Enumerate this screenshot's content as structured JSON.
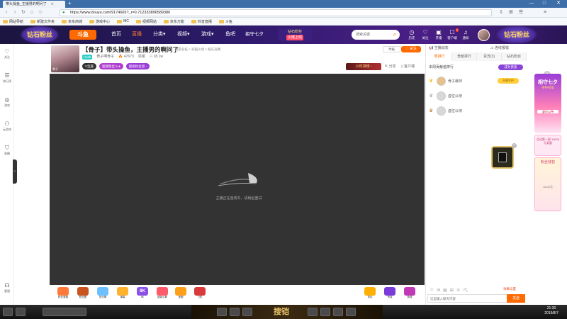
{
  "browser": {
    "tab_title": "带头操鱼_主播男的啊问了",
    "new_tab_icon": "+",
    "url": "https://www.douyu.com/9174665?_r=0.712333896589386",
    "window_controls": [
      "—",
      "□",
      "✕"
    ],
    "bookmarks": [
      "网站导航",
      "新建文件夹",
      "京东商城",
      "游戏中心",
      "MC",
      "视频网站",
      "京东万能",
      "抖音直播",
      "斗鱼"
    ]
  },
  "header": {
    "banner_left_text": "钻石粉丝",
    "logo_text": "斗鱼",
    "nav": [
      "首页",
      "直播",
      "分类",
      "视频",
      "游戏",
      "鱼吧"
    ],
    "qixi": "相守七夕",
    "diamond_title": "钻石粉丝",
    "diamond_badge": "火爆上线",
    "search_placeholder": "搜索关键",
    "icons": [
      {
        "name": "history",
        "glyph": "◷",
        "label": "历史"
      },
      {
        "name": "follow",
        "glyph": "♡",
        "label": "关注"
      },
      {
        "name": "live",
        "glyph": "▣",
        "label": "开播"
      },
      {
        "name": "client",
        "glyph": "☐",
        "label": "客户端"
      },
      {
        "name": "notice",
        "glyph": "♫",
        "label": "通知"
      }
    ],
    "client_badge": "7",
    "banner_right_text": "钻石粉丝"
  },
  "left_nav": [
    {
      "glyph": "♡",
      "label": "关注"
    },
    {
      "glyph": "☰",
      "label": "排行榜"
    },
    {
      "glyph": "◎",
      "label": "游戏"
    },
    {
      "glyph": "⚇",
      "label": "云游戏"
    },
    {
      "glyph": "⛉",
      "label": "直播"
    },
    {
      "glyph": "☊",
      "label": "客服"
    }
  ],
  "room": {
    "avatar_label": "骨子",
    "title": "【骨子】带头操鱼，主播男的啊问了",
    "category": "网游竞技 > 穿越火线 > 娱乐竞赛",
    "level": "LV20",
    "anchor": "骨子啊骨子",
    "heat": "47673",
    "fans": "28.1w",
    "tags": [
      {
        "text": "V宝座",
        "color": "#333333"
      },
      {
        "text": "超能粉丝 5 ●",
        "color": "#b03fd0"
      },
      {
        "text": "超级粉丝团 ›",
        "color": "#9b3cd8"
      }
    ],
    "report": "举报",
    "follow": "关注",
    "rank_btn": "小时排榜 ›",
    "share": "分享",
    "download": "客户端"
  },
  "player": {
    "loading_text": "主播正在连线中，请稍后重试"
  },
  "gifts": [
    {
      "label": "粉丝宝箱",
      "color": "#ff7a3a"
    },
    {
      "label": "粉丝团",
      "color": "#c9541f"
    },
    {
      "label": "荧光棒",
      "color": "#6ec0ff"
    },
    {
      "label": "弹幕",
      "color": "#ffb22e"
    },
    {
      "label": "8K",
      "color": "#8a52e6"
    },
    {
      "label": "超级火箭",
      "color": "#ff5a6a"
    },
    {
      "label": "宝箱",
      "color": "#ff9f1a"
    },
    {
      "label": "飞机",
      "color": "#d93a3a"
    },
    {
      "label": "背包",
      "color": "#ffb000"
    },
    {
      "label": "贵族",
      "color": "#7a3cd8"
    },
    {
      "label": "商城",
      "color": "#c03ab8"
    }
  ],
  "right_panel": {
    "top_title": "主播动态",
    "top_right": "连线报错",
    "tabs": [
      "周排行",
      "贡献排行",
      "贵宾(3)",
      "钻石粉丝"
    ],
    "rank_caption": "本周贡献值排行",
    "join_vip": "成为贵族",
    "ranks": [
      {
        "crown": "♛",
        "crown_color": "#f4b400",
        "name": "骨子最帅"
      },
      {
        "crown": "♛",
        "crown_color": "#a8a8a8",
        "name": "虚位以待"
      },
      {
        "crown": "♛",
        "crown_color": "#c27c3a",
        "name": "虚位以待"
      }
    ],
    "guard_btn": "开通守护",
    "chat_tools": [
      "☺",
      "✉",
      "▤",
      "⊞",
      "♔",
      "⛏"
    ],
    "danmu_label": "弹幕设置",
    "chat_placeholder": "这里输入聊天内容",
    "send": "发送"
  },
  "promos": {
    "top_title": "相守七夕",
    "top_sub": "守护冠军",
    "top_btn": "虚位以待",
    "mid_text": "活动第一周 10000元奖励",
    "bot_title": "粉丝钱包",
    "bot_sub": "15.00元",
    "close": "×"
  },
  "taskbar": {
    "center_logo": "搜铠",
    "time": "21:30",
    "date": "2019/8/7"
  }
}
